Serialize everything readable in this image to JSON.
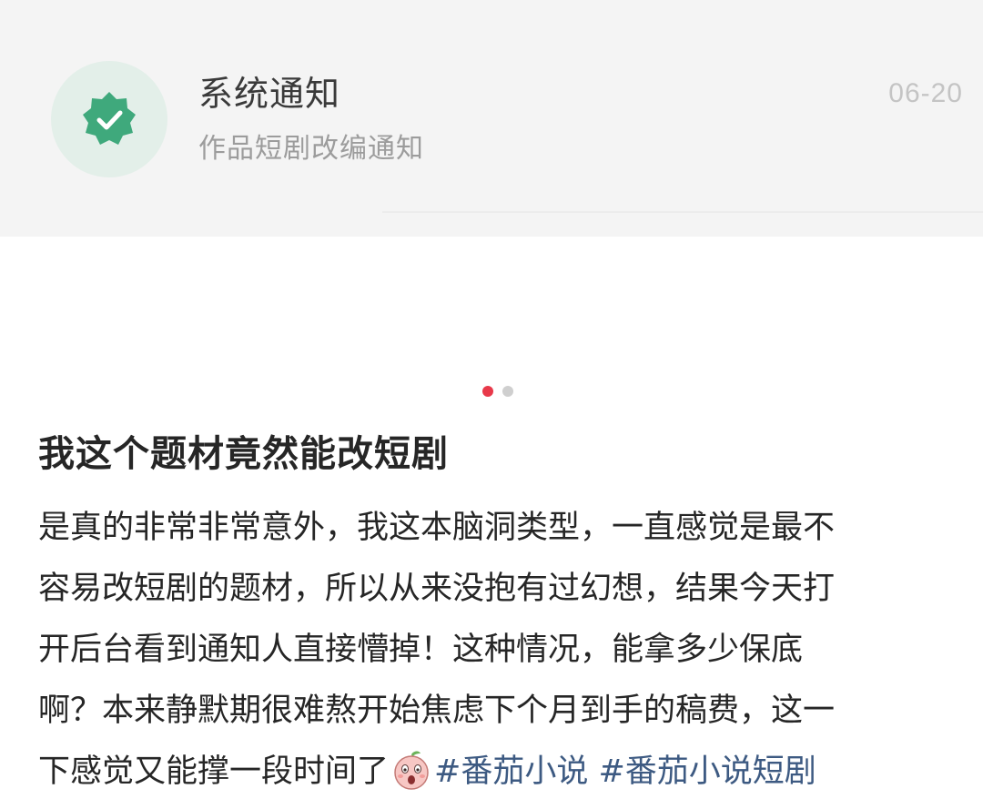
{
  "notification": {
    "title": "系统通知",
    "subtitle": "作品短剧改编通知",
    "date": "06-20",
    "icon": "verified-badge-icon",
    "accent_color": "#3fa97c"
  },
  "carousel": {
    "total": 2,
    "active_index": 0,
    "active_color": "#e8394a"
  },
  "post": {
    "title": "我这个题材竟然能改短剧",
    "body_lines": [
      "是真的非常非常意外，我这本脑洞类型，一直感觉是最不",
      "容易改短剧的题材，所以从来没抱有过幻想，结果今天打",
      "开后台看到通知人直接懵掉！这种情况，能拿多少保底",
      "啊？本来静默期很难熬开始焦虑下个月到手的稿费，这一"
    ],
    "last_line_text": "下感觉又能撑一段时间了",
    "emoji": "peach-shocked-emoji-icon",
    "hashtags": [
      "#番茄小说",
      "#番茄小说短剧"
    ],
    "hashtag_color": "#3d5a82"
  }
}
